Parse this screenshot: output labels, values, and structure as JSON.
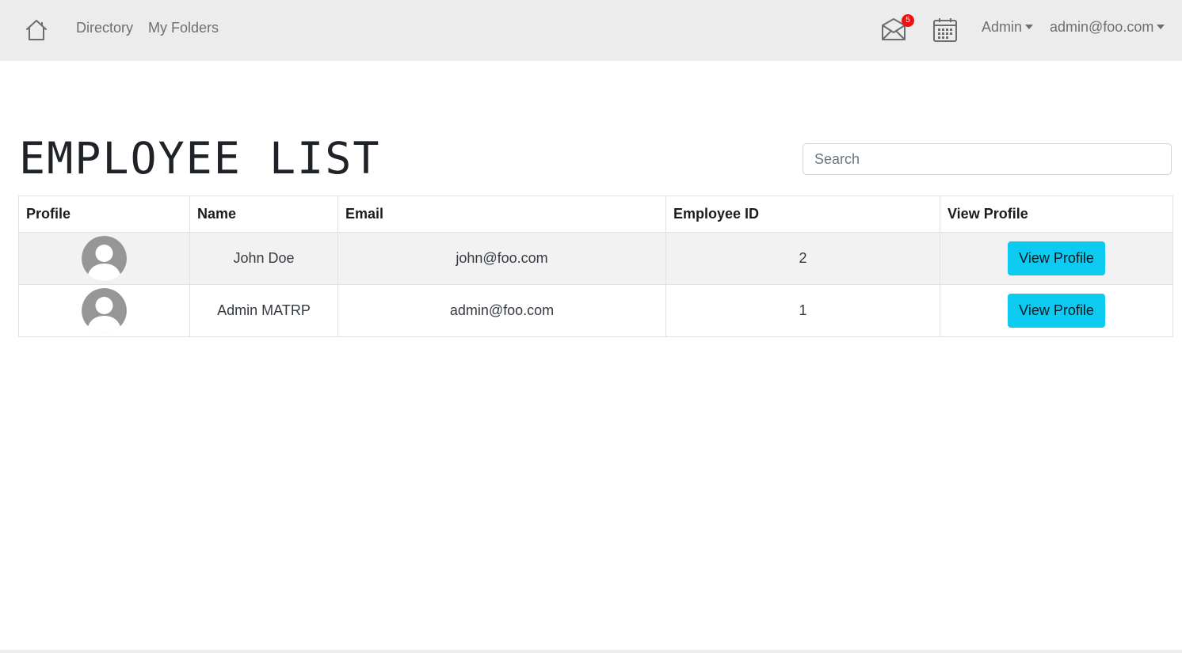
{
  "nav": {
    "home_icon": "home-icon",
    "links": [
      "Directory",
      "My Folders"
    ],
    "mail_icon": "envelope-icon",
    "mail_badge": "5",
    "calendar_icon": "calendar-icon",
    "admin_dropdown": "Admin",
    "user_dropdown": "admin@foo.com"
  },
  "main": {
    "title": "EMPLOYEE LIST",
    "search": {
      "placeholder": "Search",
      "value": ""
    }
  },
  "table": {
    "headers": [
      "Profile",
      "Name",
      "Email",
      "Employee ID",
      "View Profile"
    ],
    "rows": [
      {
        "avatar_icon": "user-avatar-icon",
        "name": "John Doe",
        "email": "john@foo.com",
        "employee_id": "2",
        "action": "View Profile"
      },
      {
        "avatar_icon": "user-avatar-icon",
        "name": "Admin MATRP",
        "email": "admin@foo.com",
        "employee_id": "1",
        "action": "View Profile"
      }
    ]
  },
  "colors": {
    "navbar_bg": "#ececec",
    "button_bg": "#0dcaf0",
    "badge_bg": "#ee1111",
    "stripe_bg": "#f2f2f2"
  }
}
